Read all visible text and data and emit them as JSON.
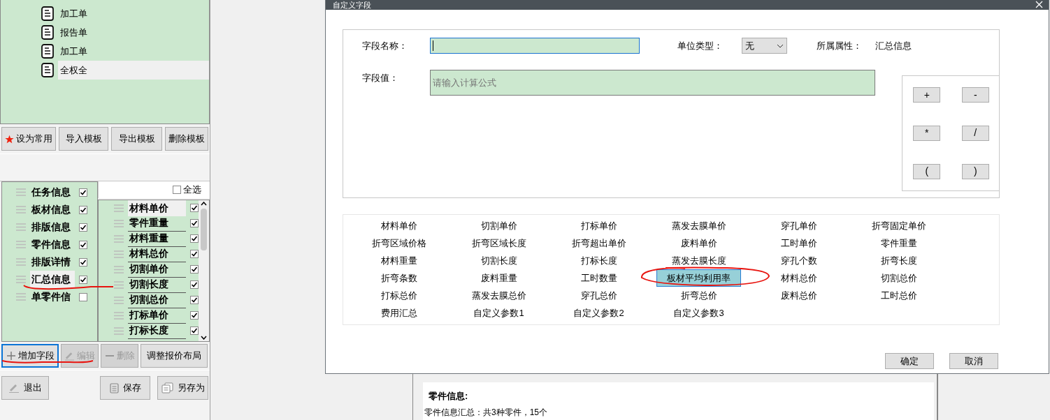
{
  "tree": {
    "items": [
      {
        "label": "加工单",
        "selected": false
      },
      {
        "label": "报告单",
        "selected": false
      },
      {
        "label": "加工单",
        "selected": false
      },
      {
        "label": "全权全",
        "selected": true
      }
    ]
  },
  "template_buttons": [
    {
      "label": "设为常用",
      "kind": "favorite"
    },
    {
      "label": "导入模板",
      "kind": "plain"
    },
    {
      "label": "导出模板",
      "kind": "plain"
    },
    {
      "label": "删除模板",
      "kind": "plain"
    }
  ],
  "categories": [
    {
      "label": "任务信息",
      "checked": true,
      "selected": false
    },
    {
      "label": "板材信息",
      "checked": true,
      "selected": false
    },
    {
      "label": "排版信息",
      "checked": true,
      "selected": false
    },
    {
      "label": "零件信息",
      "checked": true,
      "selected": false
    },
    {
      "label": "排版详情",
      "checked": true,
      "selected": false
    },
    {
      "label": "汇总信息",
      "checked": true,
      "selected": true
    },
    {
      "label": "单零件信",
      "checked": false,
      "selected": false
    }
  ],
  "fields": {
    "select_all": {
      "label": "全选",
      "checked": false
    },
    "items": [
      {
        "label": "材料单价",
        "checked": true,
        "selected": true
      },
      {
        "label": "零件重量",
        "checked": true,
        "selected": false
      },
      {
        "label": "材料重量",
        "checked": true,
        "selected": false
      },
      {
        "label": "材料总价",
        "checked": true,
        "selected": false
      },
      {
        "label": "切割单价",
        "checked": true,
        "selected": false
      },
      {
        "label": "切割长度",
        "checked": true,
        "selected": false
      },
      {
        "label": "切割总价",
        "checked": true,
        "selected": false
      },
      {
        "label": "打标单价",
        "checked": true,
        "selected": false
      },
      {
        "label": "打标长度",
        "checked": true,
        "selected": false
      }
    ]
  },
  "field_buttons": [
    {
      "label": "增加字段",
      "kind": "plus",
      "disabled": false,
      "focused": true
    },
    {
      "label": "编辑",
      "kind": "pencil",
      "disabled": true,
      "focused": false
    },
    {
      "label": "删除",
      "kind": "minus",
      "disabled": true,
      "focused": false
    },
    {
      "label": "调整报价布局",
      "kind": "plain",
      "disabled": false,
      "focused": false
    }
  ],
  "footer_buttons": [
    {
      "label": "退出",
      "kind": "pencil"
    },
    {
      "label": "保存",
      "kind": "disk"
    },
    {
      "label": "另存为",
      "kind": "copy"
    }
  ],
  "dialog": {
    "title": "自定义字段",
    "name_label": "字段名称：",
    "unit_label": "单位类型：",
    "unit_value": "无",
    "attr_label": "所属属性：",
    "attr_value": "汇总信息",
    "value_label": "字段值：",
    "value_placeholder": "请输入计算公式",
    "operators": [
      "+",
      "-",
      "*",
      "/",
      "(",
      ")"
    ],
    "field_options": [
      {
        "label": "材料单价",
        "selected": false
      },
      {
        "label": "切割单价",
        "selected": false
      },
      {
        "label": "打标单价",
        "selected": false
      },
      {
        "label": "蒸发去膜单价",
        "selected": false
      },
      {
        "label": "穿孔单价",
        "selected": false
      },
      {
        "label": "折弯固定单价",
        "selected": false
      },
      {
        "label": "折弯区域价格",
        "selected": false
      },
      {
        "label": "折弯区域长度",
        "selected": false
      },
      {
        "label": "折弯超出单价",
        "selected": false
      },
      {
        "label": "废料单价",
        "selected": false
      },
      {
        "label": "工时单价",
        "selected": false
      },
      {
        "label": "零件重量",
        "selected": false
      },
      {
        "label": "材料重量",
        "selected": false
      },
      {
        "label": "切割长度",
        "selected": false
      },
      {
        "label": "打标长度",
        "selected": false
      },
      {
        "label": "蒸发去膜长度",
        "selected": false
      },
      {
        "label": "穿孔个数",
        "selected": false
      },
      {
        "label": "折弯长度",
        "selected": false
      },
      {
        "label": "折弯条数",
        "selected": false
      },
      {
        "label": "废料重量",
        "selected": false
      },
      {
        "label": "工时数量",
        "selected": false
      },
      {
        "label": "板材平均利用率",
        "selected": true
      },
      {
        "label": "材料总价",
        "selected": false
      },
      {
        "label": "切割总价",
        "selected": false
      },
      {
        "label": "打标总价",
        "selected": false
      },
      {
        "label": "蒸发去膜总价",
        "selected": false
      },
      {
        "label": "穿孔总价",
        "selected": false
      },
      {
        "label": "折弯总价",
        "selected": false
      },
      {
        "label": "废料总价",
        "selected": false
      },
      {
        "label": "工时总价",
        "selected": false
      },
      {
        "label": "费用汇总",
        "selected": false
      },
      {
        "label": "自定义参数1",
        "selected": false
      },
      {
        "label": "自定义参数2",
        "selected": false
      },
      {
        "label": "自定义参数3",
        "selected": false
      }
    ],
    "buttons": [
      "确定",
      "取消"
    ]
  },
  "document": {
    "heading": "零件信息:",
    "summary": "零件信息汇总：共3种零件，15个"
  }
}
